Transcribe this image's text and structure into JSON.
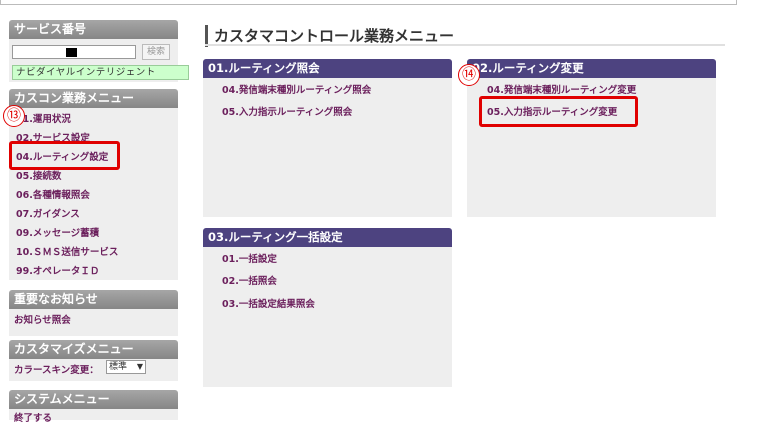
{
  "sidebar": {
    "service_number": {
      "title": "サービス番号",
      "search_label": "検索",
      "company_name": "ナビダイヤルインテリジェント"
    },
    "kascon_menu": {
      "title": "カスコン業務メニュー",
      "items": [
        {
          "label": "01.運用状況"
        },
        {
          "label": "02.サービス設定"
        },
        {
          "label": "04.ルーティング設定"
        },
        {
          "label": "05.接続数"
        },
        {
          "label": "06.各種情報照会"
        },
        {
          "label": "07.ガイダンス"
        },
        {
          "label": "09.メッセージ蓄積"
        },
        {
          "label": "10.ＳＭＳ送信サービス"
        },
        {
          "label": "99.オペレータＩＤ"
        }
      ]
    },
    "notices": {
      "title": "重要なお知らせ",
      "link": "お知らせ照会"
    },
    "customize": {
      "title": "カスタマイズメニュー",
      "skin_label": "カラースキン変更：",
      "skin_value": "標準"
    },
    "system": {
      "title": "システムメニュー",
      "logout": "終了する"
    }
  },
  "main": {
    "title": "カスタマコントロール業務メニュー",
    "panels": [
      {
        "title": "01.ルーティング照会",
        "links": [
          "04.発信端末種別ルーティング照会",
          "05.入力指示ルーティング照会"
        ]
      },
      {
        "title": "02.ルーティング変更",
        "links": [
          "04.発信端末種別ルーティング変更",
          "05.入力指示ルーティング変更"
        ]
      },
      {
        "title": "03.ルーティング一括設定",
        "links": [
          "01.一括設定",
          "02.一括照会",
          "03.一括設定結果照会"
        ]
      }
    ]
  },
  "annotations": {
    "step13": "⑬",
    "step14": "⑭",
    "highlight_color": "#e00000"
  }
}
